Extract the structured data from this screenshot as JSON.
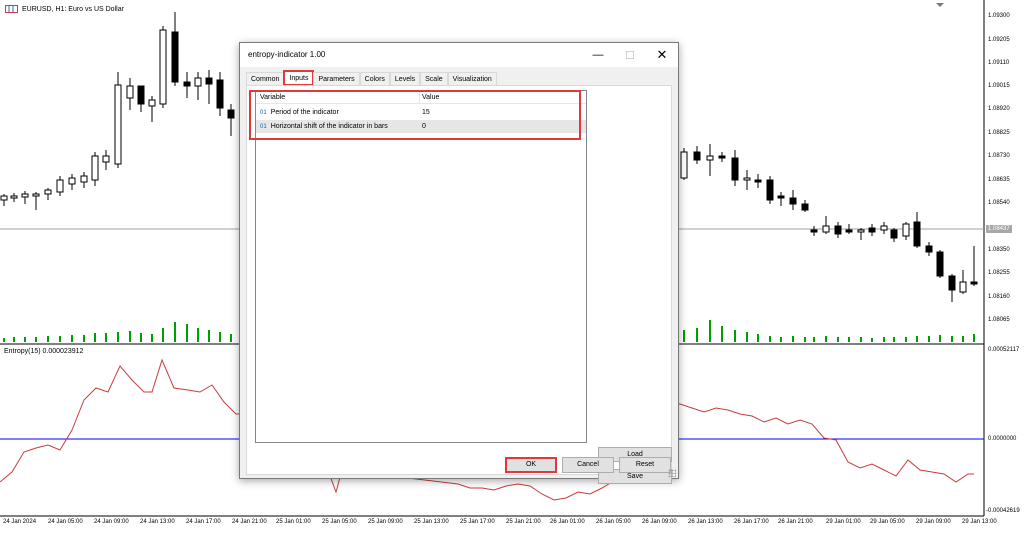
{
  "chart": {
    "symbol_label": "EURUSD, H1:  Euro vs US Dollar",
    "price_axis": [
      "1.09300",
      "1.09205",
      "1.09110",
      "1.09015",
      "1.08920",
      "1.08825",
      "1.08730",
      "1.08635",
      "1.08540",
      "1.08350",
      "1.08255",
      "1.08160",
      "1.08065"
    ],
    "current_price": "1.08437",
    "time_axis": [
      "24 Jan 2024",
      "24 Jan 05:00",
      "24 Jan 09:00",
      "24 Jan 13:00",
      "24 Jan 17:00",
      "24 Jan 21:00",
      "25 Jan 01:00",
      "25 Jan 05:00",
      "25 Jan 09:00",
      "25 Jan 13:00",
      "25 Jan 17:00",
      "25 Jan 21:00",
      "26 Jan 01:00",
      "26 Jan 05:00",
      "26 Jan 09:00",
      "26 Jan 13:00",
      "26 Jan 17:00",
      "26 Jan 21:00",
      "29 Jan 01:00",
      "29 Jan 05:00",
      "29 Jan 09:00",
      "29 Jan 13:00"
    ],
    "indicator_label": "Entropy(15) 0.000023912",
    "indicator_axis": {
      "top": "0.00052117",
      "zero": "0.0000000",
      "bottom": "-0.00042619"
    },
    "colors": {
      "bull": "#ffffff",
      "bear": "#000000",
      "volume": "#00a000",
      "indicator": "#c83c3c",
      "zero_line": "#0000ff",
      "price_line": "#a0a0a0"
    }
  },
  "dialog": {
    "title": "entropy-indicator 1.00",
    "window_buttons": {
      "minimize": "—",
      "maximize": "☐",
      "close": "✕"
    },
    "tabs": [
      {
        "label": "Common",
        "active": false
      },
      {
        "label": "Inputs",
        "active": true
      },
      {
        "label": "Parameters",
        "active": false
      },
      {
        "label": "Colors",
        "active": false
      },
      {
        "label": "Levels",
        "active": false
      },
      {
        "label": "Scale",
        "active": false
      },
      {
        "label": "Visualization",
        "active": false
      }
    ],
    "table": {
      "headers": {
        "variable": "Variable",
        "value": "Value"
      },
      "rows": [
        {
          "type": "01",
          "variable": "Period of the indicator",
          "value": "15"
        },
        {
          "type": "01",
          "variable": "Horizontal shift of the indicator in bars",
          "value": "0"
        }
      ]
    },
    "buttons": {
      "load": "Load",
      "save": "Save",
      "ok": "OK",
      "cancel": "Cancel",
      "reset": "Reset"
    },
    "highlight_color": "#e0393c"
  }
}
